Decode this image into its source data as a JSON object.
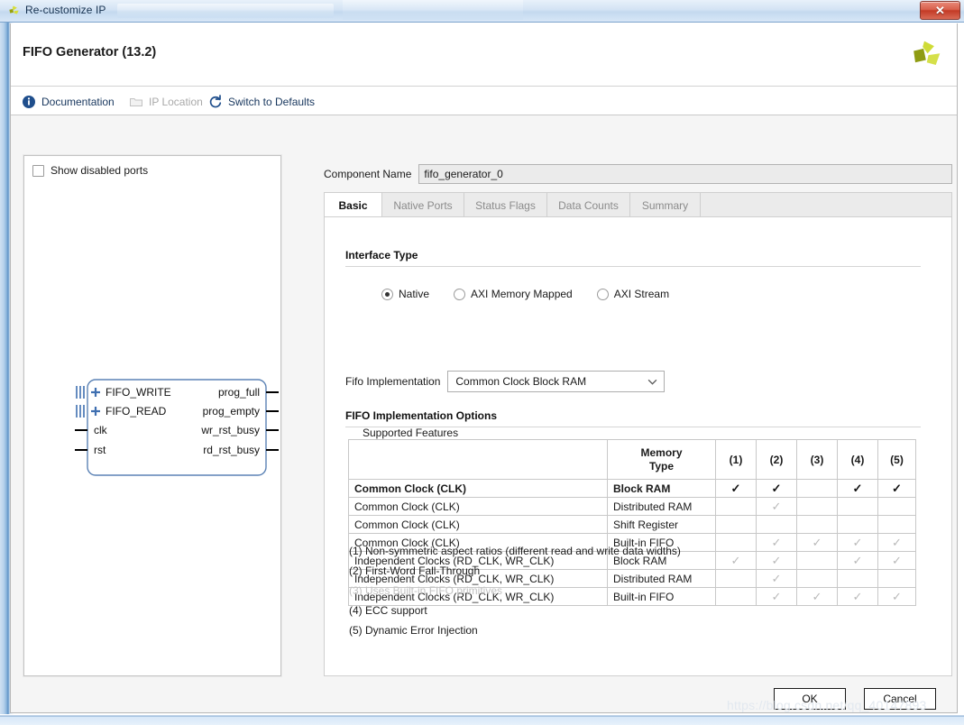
{
  "window": {
    "title": "Re-customize IP",
    "app_icon": "xilinx-logo-icon",
    "close_label": "✕"
  },
  "banner": {
    "title": "FIFO Generator (13.2)",
    "logo": "xilinx-logo-icon"
  },
  "toolbar": {
    "items": [
      {
        "label": "Documentation",
        "icon": "info-icon",
        "disabled": false
      },
      {
        "label": "IP Location",
        "icon": "folder-icon",
        "disabled": true
      },
      {
        "label": "Switch to Defaults",
        "icon": "refresh-icon",
        "disabled": false
      }
    ]
  },
  "left_panel": {
    "show_disabled_ports": {
      "label": "Show disabled ports",
      "checked": false
    },
    "symbol": {
      "inputs_bus": [
        "FIFO_WRITE",
        "FIFO_READ"
      ],
      "inputs_pin": [
        "clk",
        "rst"
      ],
      "outputs_pin": [
        "prog_full",
        "prog_empty",
        "wr_rst_busy",
        "rd_rst_busy"
      ]
    }
  },
  "component_name": {
    "label": "Component Name",
    "value": "fifo_generator_0"
  },
  "tabs": [
    {
      "label": "Basic",
      "active": true
    },
    {
      "label": "Native Ports",
      "active": false
    },
    {
      "label": "Status Flags",
      "active": false
    },
    {
      "label": "Data Counts",
      "active": false
    },
    {
      "label": "Summary",
      "active": false
    }
  ],
  "basic": {
    "interface_type": {
      "heading": "Interface Type",
      "options": [
        {
          "label": "Native",
          "selected": true
        },
        {
          "label": "AXI Memory Mapped",
          "selected": false
        },
        {
          "label": "AXI Stream",
          "selected": false
        }
      ]
    },
    "fifo_implementation": {
      "label": "Fifo Implementation",
      "value": "Common Clock Block RAM"
    },
    "implementation_options": {
      "heading": "FIFO Implementation Options",
      "supported_features_label": "Supported Features",
      "table": {
        "headers": [
          "",
          "Memory\nType",
          "(1)",
          "(2)",
          "(3)",
          "(4)",
          "(5)"
        ],
        "header_blank": "",
        "header_memory_type_line1": "Memory",
        "header_memory_type_line2": "Type",
        "header_cols": [
          "(1)",
          "(2)",
          "(3)",
          "(4)",
          "(5)"
        ],
        "rows": [
          {
            "clock": "Common Clock (CLK)",
            "memory": "Block RAM",
            "marks": [
              "on",
              "on",
              "",
              "on",
              "on"
            ],
            "highlighted": true
          },
          {
            "clock": "Common Clock (CLK)",
            "memory": "Distributed RAM",
            "marks": [
              "",
              "dim",
              "",
              "",
              ""
            ],
            "highlighted": false
          },
          {
            "clock": "Common Clock (CLK)",
            "memory": "Shift Register",
            "marks": [
              "",
              "",
              "",
              "",
              ""
            ],
            "highlighted": false
          },
          {
            "clock": "Common Clock (CLK)",
            "memory": "Built-in FIFO",
            "marks": [
              "",
              "dim",
              "dim",
              "dim",
              "dim"
            ],
            "highlighted": false
          },
          {
            "clock": "Independent Clocks (RD_CLK, WR_CLK)",
            "memory": "Block RAM",
            "marks": [
              "dim",
              "dim",
              "",
              "dim",
              "dim"
            ],
            "highlighted": false
          },
          {
            "clock": "Independent Clocks (RD_CLK, WR_CLK)",
            "memory": "Distributed RAM",
            "marks": [
              "",
              "dim",
              "",
              "",
              ""
            ],
            "highlighted": false
          },
          {
            "clock": "Independent Clocks (RD_CLK, WR_CLK)",
            "memory": "Built-in FIFO",
            "marks": [
              "",
              "dim",
              "dim",
              "dim",
              "dim"
            ],
            "highlighted": false
          }
        ],
        "check_glyph": "✓"
      },
      "footnotes": [
        {
          "text": "(1) Non-symmetric aspect ratios (different read and write data widths)",
          "dim": false
        },
        {
          "text": "(2) First-Word Fall-Through",
          "dim": false
        },
        {
          "text": "(3) Uses Built-in FIFO primitives",
          "dim": true
        },
        {
          "text": "(4) ECC support",
          "dim": false
        },
        {
          "text": "(5) Dynamic Error Injection",
          "dim": false
        }
      ]
    }
  },
  "footer": {
    "ok_label": "OK",
    "cancel_label": "Cancel"
  },
  "watermark": "https://blog.csdn.net/qq_40147893"
}
